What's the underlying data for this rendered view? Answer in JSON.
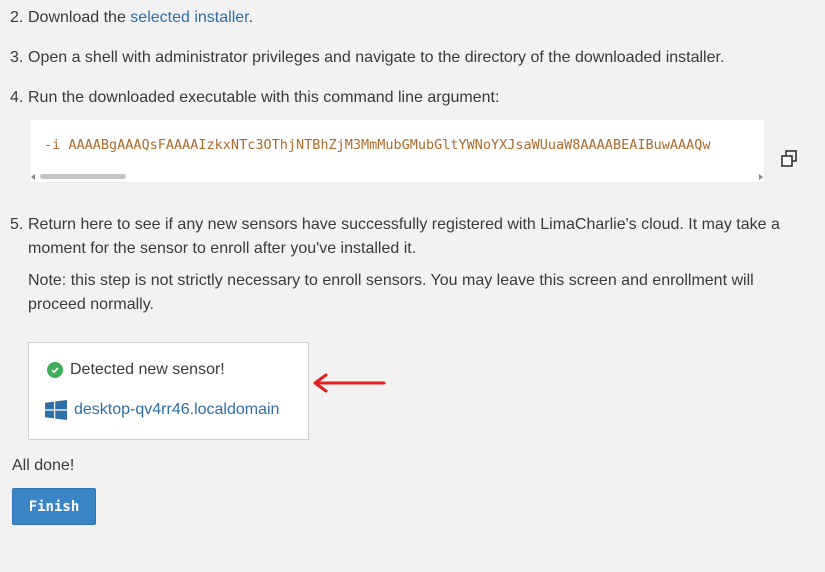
{
  "steps": [
    {
      "num": "2.",
      "prefix": "Download the ",
      "link": "selected installer",
      "suffix": "."
    },
    {
      "num": "3.",
      "text": "Open a shell with administrator privileges and navigate to the directory of the downloaded installer."
    },
    {
      "num": "4.",
      "text": "Run the downloaded executable with this command line argument:"
    },
    {
      "num": "5.",
      "text": "Return here to see if any new sensors have successfully registered with LimaCharlie's cloud. It may take a moment for the sensor to enroll after you've installed it."
    }
  ],
  "command": "-i AAAABgAAAQsFAAAAIzkxNTc3OThjNTBhZjM3MmMubGMubGltYWNoYXJsaWUuaW8AAAABEAIBuwAAAQw",
  "note": "Note: this step is not strictly necessary to enroll sensors. You may leave this screen and enrollment will proceed normally.",
  "sensor": {
    "status": "Detected new sensor!",
    "hostname": "desktop-qv4rr46.localdomain",
    "icons": {
      "status": "check-circle-icon",
      "os": "windows-icon"
    }
  },
  "all_done": "All done!",
  "finish_label": "Finish",
  "colors": {
    "link": "#2f6fa8",
    "code": "#b06a2a",
    "button": "#3a85c6",
    "success": "#3fae5a",
    "annotation_arrow": "#e02020"
  }
}
